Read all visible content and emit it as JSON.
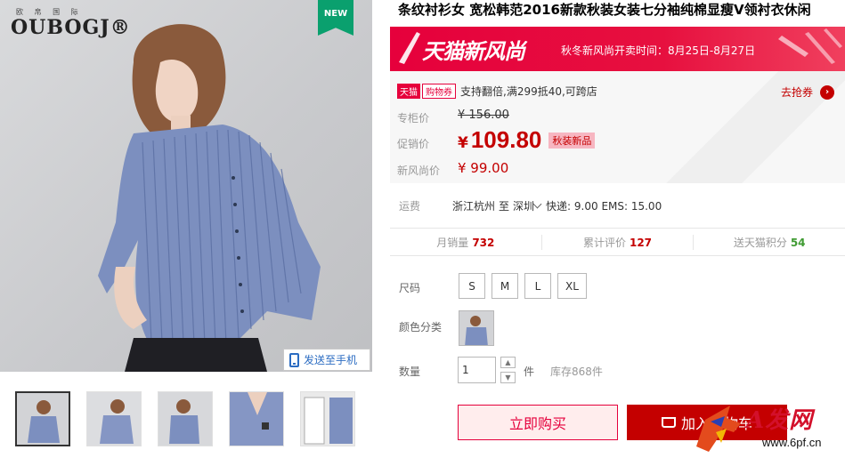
{
  "brand": {
    "small_text": "欧 帛 国 际",
    "name": "OUBOGJ®"
  },
  "badge_new": "NEW",
  "send_to_phone": "发送至手机",
  "product": {
    "title": "条纹衬衫女 宽松韩范2016新款秋装女装七分袖纯棉显瘦V领衬衣休闲"
  },
  "promo": {
    "logo": "天猫新风尚",
    "time_text": "秋冬新风尚开卖时间：8月25日-8月27日"
  },
  "coupon": {
    "tag_tmall": "天猫",
    "tag_coupon": "购物券",
    "text": "支持翻倍,满299抵40,可跨店",
    "grab_label": "去抢券"
  },
  "prices": {
    "original_label": "专柜价",
    "original_value": "¥ 156.00",
    "promo_label": "促销价",
    "promo_yen": "¥",
    "promo_value": "109.80",
    "promo_tag": "秋装新品",
    "new_label": "新风尚价",
    "new_value": "¥ 99.00"
  },
  "shipping": {
    "label": "运费",
    "from": "浙江杭州",
    "to_word": "至",
    "to": "深圳",
    "fee": "快递: 9.00 EMS: 15.00"
  },
  "stats": {
    "monthly_label": "月销量",
    "monthly_value": "732",
    "reviews_label": "累计评价",
    "reviews_value": "127",
    "points_label": "送天猫积分",
    "points_value": "54"
  },
  "size": {
    "label": "尺码",
    "options": [
      "S",
      "M",
      "L",
      "XL"
    ]
  },
  "color": {
    "label": "颜色分类"
  },
  "quantity": {
    "label": "数量",
    "value": "1",
    "unit": "件",
    "stock": "库存868件"
  },
  "actions": {
    "buy_now": "立即购买",
    "add_cart": "加入购物车"
  },
  "watermark": {
    "text": "A发网",
    "url": "www.6pf.cn"
  },
  "colors": {
    "tmall_red": "#e6003c",
    "price_red": "#c40000",
    "green": "#3f9b32",
    "link_blue": "#2b6cc2"
  }
}
